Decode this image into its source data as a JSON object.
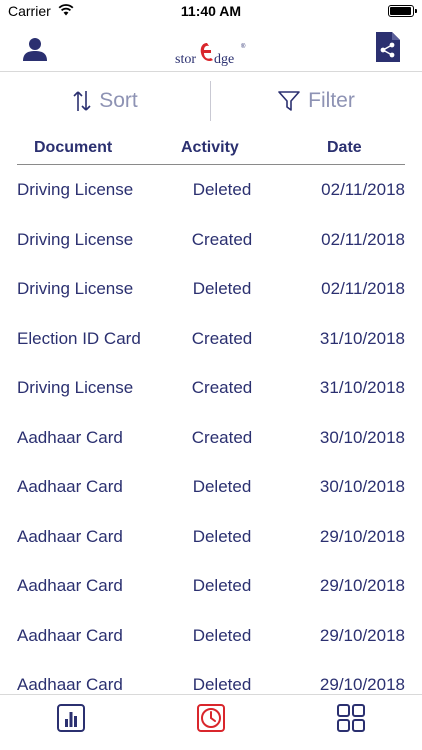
{
  "status_bar": {
    "carrier": "Carrier",
    "time": "11:40 AM"
  },
  "nav": {
    "brand_logo_text": "storEdge®"
  },
  "toolbar": {
    "sort_label": "Sort",
    "filter_label": "Filter"
  },
  "table": {
    "columns": [
      "Document",
      "Activity",
      "Date"
    ],
    "rows": [
      {
        "document": "Driving License",
        "activity": "Deleted",
        "date": "02/11/2018"
      },
      {
        "document": "Driving License",
        "activity": "Created",
        "date": "02/11/2018"
      },
      {
        "document": "Driving License",
        "activity": "Deleted",
        "date": "02/11/2018"
      },
      {
        "document": "Election ID Card",
        "activity": "Created",
        "date": "31/10/2018"
      },
      {
        "document": "Driving License",
        "activity": "Created",
        "date": "31/10/2018"
      },
      {
        "document": "Aadhaar Card",
        "activity": "Created",
        "date": "30/10/2018"
      },
      {
        "document": "Aadhaar Card",
        "activity": "Deleted",
        "date": "30/10/2018"
      },
      {
        "document": "Aadhaar Card",
        "activity": "Deleted",
        "date": "29/10/2018"
      },
      {
        "document": "Aadhaar Card",
        "activity": "Deleted",
        "date": "29/10/2018"
      },
      {
        "document": "Aadhaar Card",
        "activity": "Deleted",
        "date": "29/10/2018"
      },
      {
        "document": "Aadhaar Card",
        "activity": "Deleted",
        "date": "29/10/2018"
      }
    ]
  },
  "tabs": [
    {
      "icon": "bar-chart-icon",
      "active": false
    },
    {
      "icon": "history-clock-icon",
      "active": true
    },
    {
      "icon": "apps-grid-icon",
      "active": false
    }
  ],
  "colors": {
    "primary": "#2b3070",
    "muted": "#8e93b4",
    "accent": "#d9262c"
  }
}
